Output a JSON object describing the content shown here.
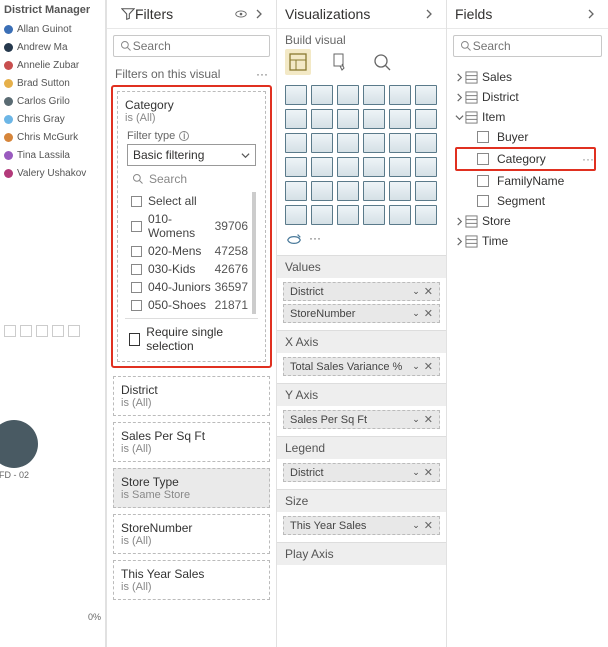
{
  "canvas": {
    "dm_title": "District Manager",
    "managers": [
      {
        "name": "Allan Guinot",
        "color": "#3b6fb6"
      },
      {
        "name": "Andrew Ma",
        "color": "#26394d"
      },
      {
        "name": "Annelie Zubar",
        "color": "#c84f4f"
      },
      {
        "name": "Brad Sutton",
        "color": "#e6b04a"
      },
      {
        "name": "Carlos Grilo",
        "color": "#5a6b73"
      },
      {
        "name": "Chris Gray",
        "color": "#6cb6e6"
      },
      {
        "name": "Chris McGurk",
        "color": "#d6853a"
      },
      {
        "name": "Tina Lassila",
        "color": "#9a5bbf"
      },
      {
        "name": "Valery Ushakov",
        "color": "#b33a7a"
      }
    ],
    "bubble_label": "FD - 02",
    "axis_label": "0%"
  },
  "filters": {
    "title": "Filters",
    "search_placeholder": "Search",
    "section": "Filters on this visual",
    "category_card": {
      "name": "Category",
      "value": "is (All)"
    },
    "filter_type_label": "Filter type",
    "filter_type_value": "Basic filtering",
    "list_search": "Search",
    "items": [
      {
        "label": "Select all",
        "count": ""
      },
      {
        "label": "010-Womens",
        "count": "39706"
      },
      {
        "label": "020-Mens",
        "count": "47258"
      },
      {
        "label": "030-Kids",
        "count": "42676"
      },
      {
        "label": "040-Juniors",
        "count": "36597"
      },
      {
        "label": "050-Shoes",
        "count": "21871"
      }
    ],
    "require_label": "Require single selection",
    "cards": [
      {
        "name": "District",
        "value": "is (All)"
      },
      {
        "name": "Sales Per Sq Ft",
        "value": "is (All)"
      },
      {
        "name": "Store Type",
        "value": "is Same Store",
        "selected": true
      },
      {
        "name": "StoreNumber",
        "value": "is (All)"
      },
      {
        "name": "This Year Sales",
        "value": "is (All)"
      }
    ]
  },
  "viz": {
    "title": "Visualizations",
    "sub": "Build visual",
    "wells": [
      {
        "header": "Values",
        "pills": [
          "District",
          "StoreNumber"
        ]
      },
      {
        "header": "X Axis",
        "pills": [
          "Total Sales Variance %"
        ]
      },
      {
        "header": "Y Axis",
        "pills": [
          "Sales Per Sq Ft"
        ]
      },
      {
        "header": "Legend",
        "pills": [
          "District"
        ]
      },
      {
        "header": "Size",
        "pills": [
          "This Year Sales"
        ]
      },
      {
        "header": "Play Axis",
        "pills": []
      }
    ]
  },
  "fields": {
    "title": "Fields",
    "search_placeholder": "Search",
    "tables": [
      {
        "name": "Sales",
        "expanded": false
      },
      {
        "name": "District",
        "expanded": false
      },
      {
        "name": "Item",
        "expanded": true,
        "fields": [
          "Buyer",
          "Category",
          "FamilyName",
          "Segment"
        ]
      },
      {
        "name": "Store",
        "expanded": false
      },
      {
        "name": "Time",
        "expanded": false
      }
    ],
    "highlighted": "Category"
  }
}
